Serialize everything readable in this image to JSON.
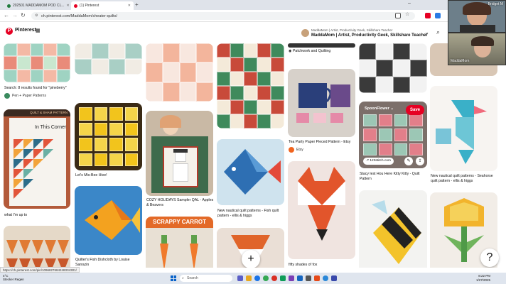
{
  "browser": {
    "tabs": [
      {
        "label": "202501 MADDAMOM POD CL...",
        "active": false
      },
      {
        "label": "(1) Pinterest",
        "active": true
      }
    ],
    "new_tab": "+",
    "url": "ch.pinterest.com/MaddaMom/cheater-quilts/",
    "status_url": "https://ch.pinterest.com/pin/1096827684248334301/"
  },
  "pinterest": {
    "brand": "Pinterest",
    "menu_icon": "▦",
    "profile_line1": "MaddaMom | Artist, Productivity Geek, Skillshare Teacher",
    "profile_line2": "MaddaMom | Artist, Productivity Geek, Skillshare Teacher"
  },
  "pins": {
    "c1_caption": "Search: 8 results found for \"pineberry\"",
    "c1_source": "Pen + Paper Patterns",
    "c1_book_tag": "QUILT & SHAM PATTERN",
    "c1_book_title": "In This Corner",
    "c1_caption2": "what I'm up to",
    "c2_caption": "Let's Mis-Bee Hive!",
    "c2_caption2": "Quilter's Fish Dishcloth by Louise Sarrazin",
    "c3_caption": "COZY HOLIDAYS Sampler QAL - Apples & Beavers",
    "c3_banner": "SCRAPPY CARROT",
    "c4_caption": "New nautical quilt patterns - Fish quilt pattern - ellis & higgs",
    "c5_caption_top": "Patchwork and Quilting",
    "c5_caption": "Tea Party Paper Pieced Pattern - Etsy",
    "c5_source": "Etsy",
    "c5_caption2": "fifty shades of fox",
    "c6_board": "SpoonFlower",
    "c6_save": "Save",
    "c6_link": "123stitch.com",
    "c6_caption": "Stacy lest Hou Here Kitty Kitty - Quilt Pattern",
    "c7_caption": "New nautical quilt patterns - Seahorse quilt pattern - ellis & higgs"
  },
  "fab": {
    "add": "+",
    "help": "?"
  },
  "webcams": [
    {
      "label": "Bridget M"
    },
    {
      "label": "MaddaMom"
    }
  ],
  "taskbar": {
    "weather_temp": "4°C",
    "weather_desc": "Stecker Regen",
    "search_placeholder": "Search",
    "time": "8:22 PM",
    "date": "1/27/2025"
  },
  "colors": {
    "pinterest_red": "#e60023",
    "taskbar": "#dfe5ee",
    "tabbar": "#dfe3ea"
  }
}
